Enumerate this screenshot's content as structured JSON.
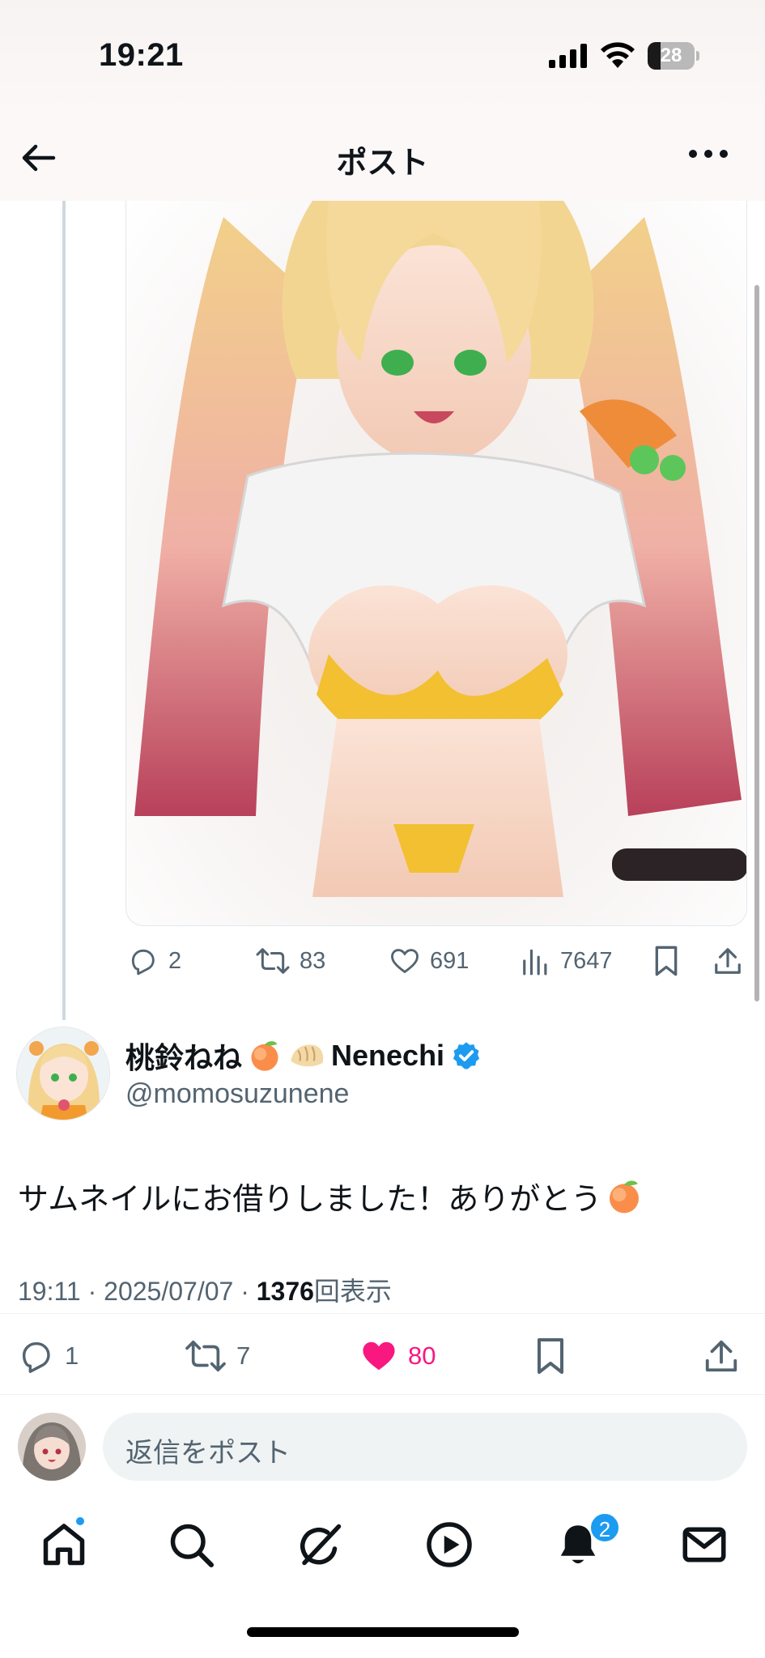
{
  "status_bar": {
    "time": "19:21",
    "battery_level": "28",
    "icons": [
      "cellular-signal-icon",
      "wifi-icon",
      "battery-icon"
    ]
  },
  "header": {
    "title": "ポスト",
    "back_icon": "arrow-left-icon",
    "more_icon": "more-horizontal-icon"
  },
  "parent_post": {
    "media": "anime-illustration-image",
    "actions": {
      "replies": "2",
      "reposts": "83",
      "likes": "691",
      "views": "7647"
    }
  },
  "post": {
    "author": {
      "display_name": "桃鈴ねね",
      "display_name_suffix": "Nenechi",
      "emojis": [
        "peach-emoji",
        "dumpling-emoji"
      ],
      "verified": true,
      "handle": "@momosuzunene"
    },
    "text": "サムネイルにお借りしました！ありがとう",
    "text_emoji": "peach-emoji",
    "time": "19:11",
    "date": "2025/07/07",
    "view_count": "1376",
    "view_label": "回表示",
    "separator": "·",
    "actions": {
      "replies": "1",
      "reposts": "7",
      "likes": "80",
      "liked": true
    }
  },
  "reply": {
    "placeholder": "返信をポスト"
  },
  "tab_bar": {
    "items": [
      "home-icon",
      "search-icon",
      "grok-icon",
      "video-icon",
      "notifications-icon",
      "messages-icon"
    ],
    "notifications_badge": "2"
  },
  "colors": {
    "accent": "#1d9bf0",
    "like": "#f91880",
    "secondary_text": "#536471"
  }
}
